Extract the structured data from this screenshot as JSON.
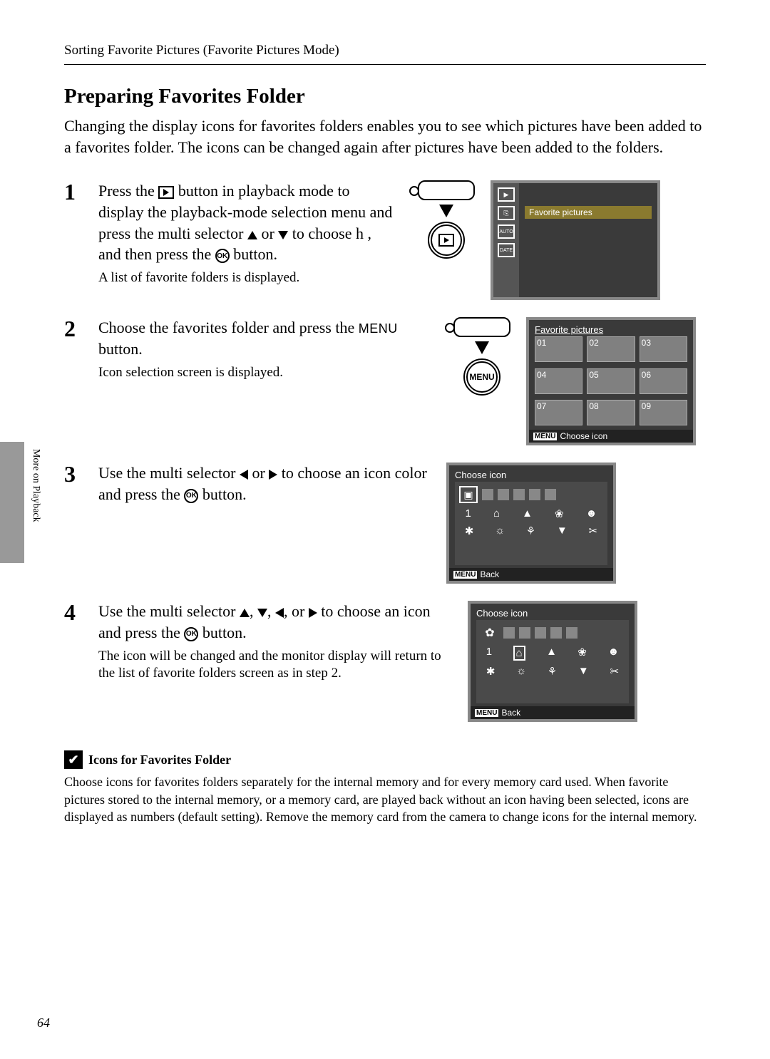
{
  "running_header": "Sorting Favorite Pictures (Favorite Pictures Mode)",
  "section_title": "Preparing Favorites Folder",
  "intro": "Changing the display icons for favorites folders enables you to see which pictures have been added to a favorites folder. The icons can be changed again after pictures have been added to the folders.",
  "steps": [
    {
      "num": "1",
      "main_before": "Press the ",
      "main_mid1": " button in playback mode to display the playback-mode selection menu and press the multi selector ",
      "main_mid2": " or ",
      "main_mid3": " to choose h , and then press the ",
      "main_after": " button.",
      "sub": "A list of favorite folders is displayed."
    },
    {
      "num": "2",
      "main_before": "Choose the favorites folder and press the ",
      "menu_text": "MENU",
      "main_after": " button.",
      "sub": "Icon selection screen is displayed."
    },
    {
      "num": "3",
      "main_before": "Use the multi selector ",
      "main_mid": " or ",
      "main_mid2": " to choose an icon color and press the ",
      "main_after": " button."
    },
    {
      "num": "4",
      "main_before": "Use the multi selector ",
      "sep": ", ",
      "or": ", or ",
      "main_mid": " to choose an icon and press the ",
      "main_after": " button.",
      "sub": "The icon will be changed and the monitor display will return to the list of favorite folders screen as in step 2."
    }
  ],
  "ok_label": "OK",
  "menu_label": "MENU",
  "side_label": "More on Playback",
  "lcd1": {
    "highlight": "Favorite pictures",
    "icons": [
      "▶",
      "⎘",
      "AUTO",
      "DATE"
    ]
  },
  "lcd2": {
    "title": "Favorite pictures",
    "cells": [
      "01",
      "02",
      "03",
      "04",
      "05",
      "06",
      "07",
      "08",
      "09"
    ],
    "footer": "Choose icon"
  },
  "lcd3": {
    "title": "Choose icon",
    "footer": "Back",
    "first_icon_a": "▣",
    "first_icon_b": "✿",
    "row2_first": "1",
    "row2": [
      "⌂",
      "▲",
      "❀",
      "☻"
    ],
    "row3": [
      "✱",
      "☼",
      "⚘",
      "▼",
      "✂"
    ]
  },
  "note": {
    "title": "Icons for Favorites Folder",
    "body": "Choose icons for favorites folders separately for the internal memory and for every memory card used. When favorite pictures stored to the internal memory, or a memory card, are played back without an icon having been selected, icons are displayed as numbers (default setting). Remove the memory card from the camera to change icons for the internal memory."
  },
  "page_num": "64"
}
